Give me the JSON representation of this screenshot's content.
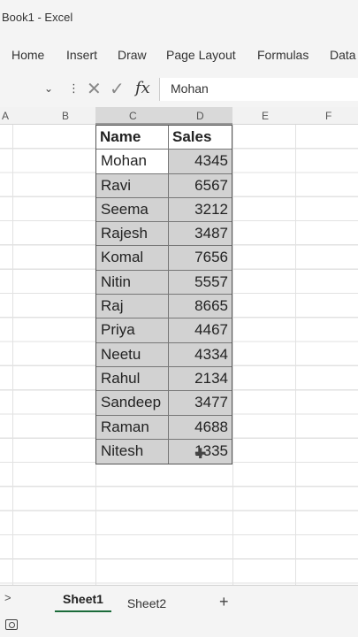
{
  "window": {
    "title": "Book1 - Excel"
  },
  "ribbon": {
    "tabs": [
      "Home",
      "Insert",
      "Draw",
      "Page Layout",
      "Formulas",
      "Data"
    ]
  },
  "formula_bar": {
    "value": "Mohan",
    "fx_label": "fx",
    "cancel_icon": "cancel-icon",
    "enter_icon": "check-icon"
  },
  "columns": [
    "A",
    "B",
    "C",
    "D",
    "E",
    "F"
  ],
  "selected_columns": [
    "C",
    "D"
  ],
  "table": {
    "headers": [
      "Name",
      "Sales"
    ],
    "rows": [
      {
        "name": "Mohan",
        "sales": "4345"
      },
      {
        "name": "Ravi",
        "sales": "6567"
      },
      {
        "name": "Seema",
        "sales": "3212"
      },
      {
        "name": "Rajesh",
        "sales": "3487"
      },
      {
        "name": "Komal",
        "sales": "7656"
      },
      {
        "name": "Nitin",
        "sales": "5557"
      },
      {
        "name": "Raj",
        "sales": "8665"
      },
      {
        "name": "Priya",
        "sales": "4467"
      },
      {
        "name": "Neetu",
        "sales": "4334"
      },
      {
        "name": "Rahul",
        "sales": "2134"
      },
      {
        "name": "Sandeep",
        "sales": "3477"
      },
      {
        "name": "Raman",
        "sales": "4688"
      },
      {
        "name": "Nitesh",
        "sales": "1335"
      }
    ]
  },
  "sheets": {
    "tabs": [
      "Sheet1",
      "Sheet2"
    ],
    "active": "Sheet1",
    "add_label": "+",
    "nav_label": ">"
  },
  "colors": {
    "selection_fill": "#d2d2d2",
    "active_tab_underline": "#1b6b3a"
  }
}
